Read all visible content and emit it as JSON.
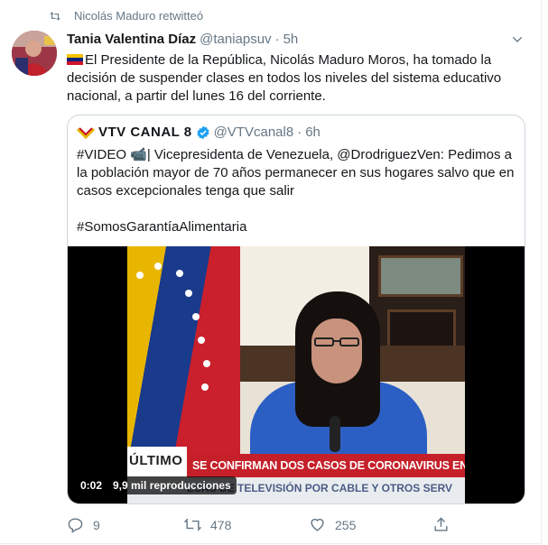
{
  "retweet": {
    "label": "Nicolás Maduro retwitteó"
  },
  "tweet": {
    "author_name": "Tania Valentina Díaz",
    "author_handle": "@taniapsuv",
    "dot": "·",
    "time": "5h",
    "text": "El Presidente de la República, Nicolás Maduro Moros, ha tomado la decisión de suspender clases en todos los niveles del sistema educativo nacional, a partir del lunes 16 del corriente."
  },
  "quote": {
    "author_name": "VTV CANAL 8",
    "author_handle": "@VTVcanal8",
    "dot": "·",
    "time": "6h",
    "text": "#VIDEO 📹| Vicepresidenta de Venezuela, @DrodriguezVen: Pedimos a la población mayor de 70 años permanecer en sus hogares salvo que en casos excepcionales tenga que salir",
    "hashtag": "#SomosGarantíaAlimentaria"
  },
  "video": {
    "lower_third_left": "ÚLTIMO",
    "lower_third_headline": "SE CONFIRMAN DOS CASOS DE CORONAVIRUS EN VENEZUELA",
    "lower_third_sub": "ESAS DE TELEVISIÓN POR CABLE Y OTROS SERV",
    "duration": "0:02",
    "views": "9,9 mil reproducciones"
  },
  "actions": {
    "replies": "9",
    "retweets": "478",
    "likes": "255"
  },
  "colors": {
    "secondary_text": "#657786",
    "border": "#ccd6dd",
    "verified": "#1da1f2",
    "headline_red": "#c52029"
  }
}
